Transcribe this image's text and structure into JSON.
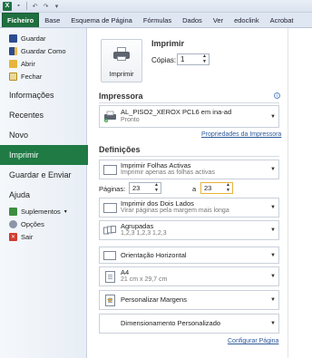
{
  "titlebar": {
    "app_icon_label": "X",
    "quick_access": [
      "save-icon",
      "undo-icon",
      "redo-icon",
      "customize-icon"
    ]
  },
  "ribbon": {
    "tabs": [
      "Ficheiro",
      "Base",
      "Esquema de Página",
      "Fórmulas",
      "Dados",
      "Ver",
      "edoclink",
      "Acrobat"
    ]
  },
  "nav": {
    "guardar": "Guardar",
    "guardar_como": "Guardar Como",
    "abrir": "Abrir",
    "fechar": "Fechar",
    "informacoes": "Informações",
    "recentes": "Recentes",
    "novo": "Novo",
    "imprimir": "Imprimir",
    "guardar_enviar": "Guardar e Enviar",
    "ajuda": "Ajuda",
    "suplementos": "Suplementos",
    "suplementos_arrow": "▾",
    "opcoes": "Opções",
    "sair": "Sair"
  },
  "print": {
    "heading": "Imprimir",
    "button_label": "Imprimir",
    "copies_label": "Cópias:",
    "copies_value": "1"
  },
  "printer": {
    "heading": "Impressora",
    "name": "AL_PISO2_XEROX PCL6 em ina-ad",
    "status": "Pronto",
    "properties_link": "Propriedades da Impressora"
  },
  "settings": {
    "heading": "Definições",
    "what": {
      "title": "Imprimir Folhas Activas",
      "subtitle": "Imprimir apenas as folhas activas"
    },
    "pages_label": "Páginas:",
    "pages_from": "23",
    "pages_to_label": "a",
    "pages_to": "23",
    "sides": {
      "title": "Imprimir dos Dois Lados",
      "subtitle": "Virar páginas pela margem mais longa"
    },
    "collate": {
      "title": "Agrupadas",
      "subtitle": "1,2,3   1,2,3   1,2,3"
    },
    "orientation": {
      "title": "Orientação Horizontal"
    },
    "paper": {
      "title": "A4",
      "subtitle": "21 cm x 29,7 cm"
    },
    "margins": {
      "title": "Personalizar Margens"
    },
    "scaling": {
      "title": "Dimensionamento Personalizado"
    },
    "page_setup_link": "Configurar Página"
  },
  "colors": {
    "file_tab": "#1f6f3f",
    "active_nav": "#1f7a44",
    "link": "#2e5a9a"
  }
}
